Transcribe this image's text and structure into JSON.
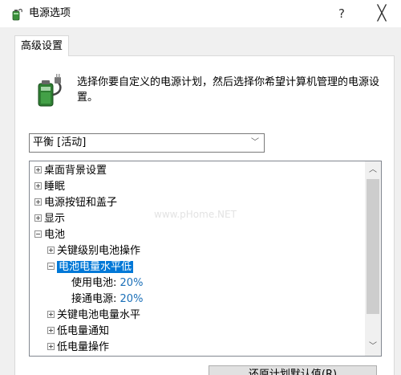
{
  "window": {
    "title": "电源选项",
    "help": "?",
    "close": "╳"
  },
  "tab": {
    "label": "高级设置"
  },
  "description": "选择你要自定义的电源计划，然后选择你希望计算机管理的电源设置。",
  "plan_select": {
    "value": "平衡 [活动]",
    "arrow": "﹀"
  },
  "tree": {
    "items": [
      {
        "label": "桌面背景设置"
      },
      {
        "label": "睡眠"
      },
      {
        "label": "电源按钮和盖子"
      },
      {
        "label": "显示"
      },
      {
        "label": "电池"
      },
      {
        "label": "关键级别电池操作"
      },
      {
        "label": "电池电量水平低"
      },
      {
        "label": "使用电池:",
        "value": "20%"
      },
      {
        "label": "接通电源:",
        "value": "20%"
      },
      {
        "label": "关键电池电量水平"
      },
      {
        "label": "低电量通知"
      },
      {
        "label": "低电量操作"
      }
    ]
  },
  "scroll": {
    "up": "︿",
    "down": "﹀"
  },
  "watermark": "www.pHome.NET",
  "buttons": {
    "restore": "还原计划默认值(R)"
  }
}
